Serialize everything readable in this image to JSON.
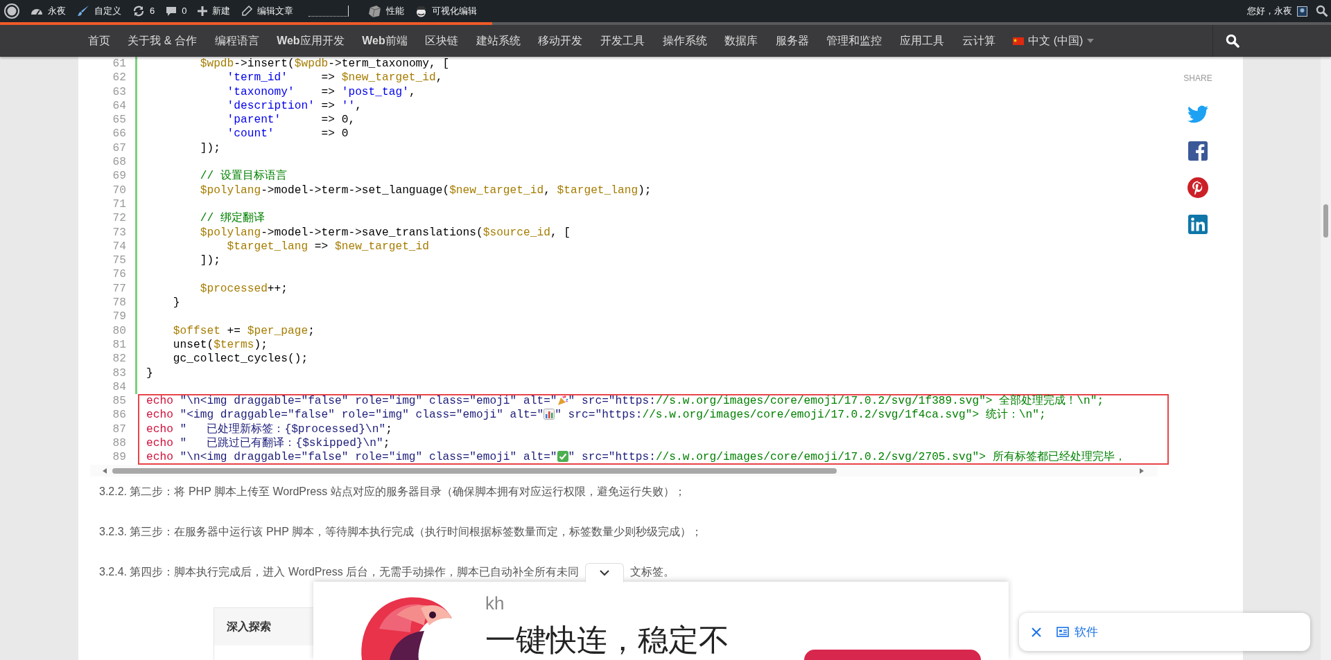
{
  "admin_bar": {
    "items": [
      {
        "kind": "logo"
      },
      {
        "kind": "dashboard",
        "label": "永夜"
      },
      {
        "kind": "customize",
        "label": "自定义"
      },
      {
        "kind": "updates",
        "label": "6"
      },
      {
        "kind": "comments",
        "label": "0"
      },
      {
        "kind": "new",
        "label": "新建"
      },
      {
        "kind": "edit",
        "label": "编辑文章"
      },
      {
        "kind": "meter"
      },
      {
        "kind": "performance",
        "label": "性能"
      },
      {
        "kind": "visual",
        "label": "可视化编辑"
      }
    ],
    "greeting": "您好，永夜"
  },
  "reading_progress": {
    "level": 0.37
  },
  "nav": {
    "items": [
      {
        "label": "首页"
      },
      {
        "label": "关于我 & 合作"
      },
      {
        "label": "编程语言"
      },
      {
        "label": "**Web**应用开发"
      },
      {
        "label": "**Web**前端"
      },
      {
        "label": "区块链"
      },
      {
        "label": "建站系统"
      },
      {
        "label": "移动开发"
      },
      {
        "label": "开发工具"
      },
      {
        "label": "操作系统"
      },
      {
        "label": "数据库"
      },
      {
        "label": "服务器"
      },
      {
        "label": "管理和监控"
      },
      {
        "label": "应用工具"
      },
      {
        "label": "云计算"
      }
    ],
    "language": {
      "label": "中文 (中国)"
    }
  },
  "code": {
    "lines": [
      {
        "number": "61",
        "highlighted": false,
        "tokens": [
          {
            "kind": "var",
            "text": "        $wpdb"
          },
          {
            "kind": "p",
            "text": "->insert("
          },
          {
            "kind": "var",
            "text": "$wpdb"
          },
          {
            "kind": "p",
            "text": "->term_taxonomy, ["
          }
        ]
      },
      {
        "number": "62",
        "highlighted": false,
        "tokens": [
          {
            "kind": "key",
            "text": "            'term_id'"
          },
          {
            "kind": "p",
            "text": "     => "
          },
          {
            "kind": "var",
            "text": "$new_target_id"
          },
          {
            "kind": "p",
            "text": ","
          }
        ]
      },
      {
        "number": "63",
        "highlighted": false,
        "tokens": [
          {
            "kind": "key",
            "text": "            'taxonomy'"
          },
          {
            "kind": "p",
            "text": "    => "
          },
          {
            "kind": "key",
            "text": "'post_tag'"
          },
          {
            "kind": "p",
            "text": ","
          }
        ]
      },
      {
        "number": "64",
        "highlighted": false,
        "tokens": [
          {
            "kind": "key",
            "text": "            'description'"
          },
          {
            "kind": "p",
            "text": " => "
          },
          {
            "kind": "key",
            "text": "''"
          },
          {
            "kind": "p",
            "text": ","
          }
        ]
      },
      {
        "number": "65",
        "highlighted": false,
        "tokens": [
          {
            "kind": "key",
            "text": "            'parent'"
          },
          {
            "kind": "p",
            "text": "      => 0,"
          }
        ]
      },
      {
        "number": "66",
        "highlighted": false,
        "tokens": [
          {
            "kind": "key",
            "text": "            'count'"
          },
          {
            "kind": "p",
            "text": "       => 0"
          }
        ]
      },
      {
        "number": "67",
        "highlighted": false,
        "tokens": [
          {
            "kind": "p",
            "text": "        ]);"
          }
        ]
      },
      {
        "number": "68",
        "highlighted": false
      },
      {
        "number": "69",
        "highlighted": false,
        "tokens": [
          {
            "kind": "cmt",
            "text": "        // 设置目标语言"
          }
        ]
      },
      {
        "number": "70",
        "highlighted": false,
        "tokens": [
          {
            "kind": "var",
            "text": "        $polylang"
          },
          {
            "kind": "p",
            "text": "->model->term->set_language("
          },
          {
            "kind": "var",
            "text": "$new_target_id"
          },
          {
            "kind": "p",
            "text": ", "
          },
          {
            "kind": "var",
            "text": "$target_lang"
          },
          {
            "kind": "p",
            "text": ");"
          }
        ]
      },
      {
        "number": "71",
        "highlighted": false
      },
      {
        "number": "72",
        "highlighted": false,
        "tokens": [
          {
            "kind": "cmt",
            "text": "        // 绑定翻译"
          }
        ]
      },
      {
        "number": "73",
        "highlighted": false,
        "tokens": [
          {
            "kind": "var",
            "text": "        $polylang"
          },
          {
            "kind": "p",
            "text": "->model->term->save_translations("
          },
          {
            "kind": "var",
            "text": "$source_id"
          },
          {
            "kind": "p",
            "text": ", ["
          }
        ]
      },
      {
        "number": "74",
        "highlighted": false,
        "tokens": [
          {
            "kind": "var",
            "text": "            $target_lang"
          },
          {
            "kind": "p",
            "text": " => "
          },
          {
            "kind": "var",
            "text": "$new_target_id"
          }
        ]
      },
      {
        "number": "75",
        "highlighted": false,
        "tokens": [
          {
            "kind": "p",
            "text": "        ]);"
          }
        ]
      },
      {
        "number": "76",
        "highlighted": false
      },
      {
        "number": "77",
        "highlighted": false,
        "tokens": [
          {
            "kind": "var",
            "text": "        $processed"
          },
          {
            "kind": "p",
            "text": "++;"
          }
        ]
      },
      {
        "number": "78",
        "highlighted": false,
        "tokens": [
          {
            "kind": "p",
            "text": "    }"
          }
        ]
      },
      {
        "number": "79",
        "highlighted": false
      },
      {
        "number": "80",
        "highlighted": false,
        "tokens": [
          {
            "kind": "var",
            "text": "    $offset"
          },
          {
            "kind": "p",
            "text": " += "
          },
          {
            "kind": "var",
            "text": "$per_page"
          },
          {
            "kind": "p",
            "text": ";"
          }
        ]
      },
      {
        "number": "81",
        "highlighted": false,
        "tokens": [
          {
            "kind": "p",
            "text": "    unset("
          },
          {
            "kind": "var",
            "text": "$terms"
          },
          {
            "kind": "p",
            "text": ");"
          }
        ]
      },
      {
        "number": "82",
        "highlighted": false,
        "tokens": [
          {
            "kind": "p",
            "text": "    gc_collect_cycles();"
          }
        ]
      },
      {
        "number": "83",
        "highlighted": false,
        "tokens": [
          {
            "kind": "p",
            "text": "}"
          }
        ]
      },
      {
        "number": "84",
        "highlighted": false
      },
      {
        "number": "85",
        "highlighted": true,
        "tokens": [
          {
            "kind": "kw",
            "text": "echo "
          },
          {
            "kind": "str",
            "text": "\"\\n<img draggable=\"false\" role=\"img\" class=\"emoji\" alt=\""
          },
          {
            "kind": "emoji"
          },
          {
            "kind": "str",
            "text": "\" src=\"https:"
          },
          {
            "kind": "cmt",
            "text": "//s.w.org/images/core/emoji/17.0.2/svg/1f389.svg\"> 全部处理完成！\\n\";"
          }
        ]
      },
      {
        "number": "86",
        "highlighted": true,
        "tokens": [
          {
            "kind": "kw",
            "text": "echo "
          },
          {
            "kind": "str",
            "text": "\"<img draggable=\"false\" role=\"img\" class=\"emoji\" alt=\""
          },
          {
            "kind": "emoji"
          },
          {
            "kind": "str",
            "text": "\" src=\"https:"
          },
          {
            "kind": "cmt",
            "text": "//s.w.org/images/core/emoji/17.0.2/svg/1f4ca.svg\"> 统计：\\n\";"
          }
        ]
      },
      {
        "number": "87",
        "highlighted": true,
        "tokens": [
          {
            "kind": "kw",
            "text": "echo "
          },
          {
            "kind": "str",
            "text": "\"   已处理新标签：{$processed}\\n\""
          },
          {
            "kind": "p",
            "text": ";"
          }
        ]
      },
      {
        "number": "88",
        "highlighted": true,
        "tokens": [
          {
            "kind": "kw",
            "text": "echo "
          },
          {
            "kind": "str",
            "text": "\"   已跳过已有翻译：{$skipped}\\n\""
          },
          {
            "kind": "p",
            "text": ";"
          }
        ]
      },
      {
        "number": "89",
        "highlighted": true,
        "tokens": [
          {
            "kind": "kw",
            "text": "echo "
          },
          {
            "kind": "str",
            "text": "\"\\n<img draggable=\"false\" role=\"img\" class=\"emoji\" alt=\""
          },
          {
            "kind": "emoji"
          },
          {
            "kind": "str",
            "text": "\" src=\"https:"
          },
          {
            "kind": "cmt",
            "text": "//s.w.org/images/core/emoji/17.0.2/svg/2705.svg\"> 所有标签都已经处理完毕，"
          }
        ]
      }
    ]
  },
  "paragraphs": [
    {
      "text": "3.2.2. 第二步：将 PHP 脚本上传至 WordPress 站点对应的服务器目录（确保脚本拥有对应运行权限，避免运行失败）；"
    },
    {
      "text": "3.2.3. 第三步：在服务器中运行该 PHP 脚本，等待脚本执行完成（执行时间根据标签数量而定，标签数量少则秒级完成）；"
    },
    {
      "text": "3.2.4. 第四步：脚本执行完成后，进入 WordPress 后台，无需手动操作，脚本已自动补全所有未同",
      "text_after_cover": "文标签。"
    }
  ],
  "share": {
    "title": "SHARE",
    "buttons": [
      {
        "kind": "twitter"
      },
      {
        "kind": "facebook"
      },
      {
        "kind": "pinterest"
      },
      {
        "kind": "linkedin"
      }
    ]
  },
  "sidebar_card": {
    "title": "深入探索"
  },
  "ad": {
    "brand": "kh",
    "headline": "一键快连，稳定不"
  },
  "toast": {
    "label": "软件"
  }
}
